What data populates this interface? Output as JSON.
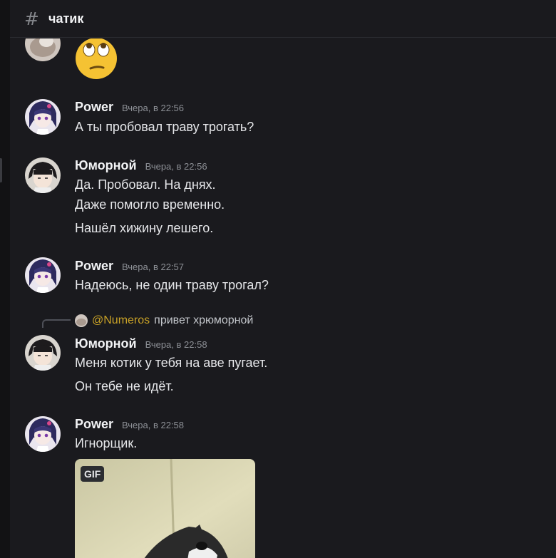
{
  "channel": {
    "icon": "hash-icon",
    "name": "чатик"
  },
  "messages": [
    {
      "user": "Power",
      "time": "Вчера, в 22:56",
      "lines": [
        "А ты пробовал траву трогать?"
      ]
    },
    {
      "user": "Юморной",
      "time": "Вчера, в 22:56",
      "lines": [
        "Да. Пробовал. На днях.",
        "Даже помогло временно.",
        "Нашёл хижину лешего."
      ]
    },
    {
      "user": "Power",
      "time": "Вчера, в 22:57",
      "lines": [
        "Надеюсь, не один траву трогал?"
      ]
    },
    {
      "reply": {
        "mention": "@Numeros",
        "text": "привет хрюморной"
      },
      "user": "Юморной",
      "time": "Вчера, в 22:58",
      "lines": [
        "Меня котик у тебя на аве пугает.",
        "Он тебе не идёт."
      ]
    },
    {
      "user": "Power",
      "time": "Вчера, в 22:58",
      "lines": [
        "Игнорщик."
      ],
      "attachment": {
        "badge": "GIF"
      }
    }
  ]
}
